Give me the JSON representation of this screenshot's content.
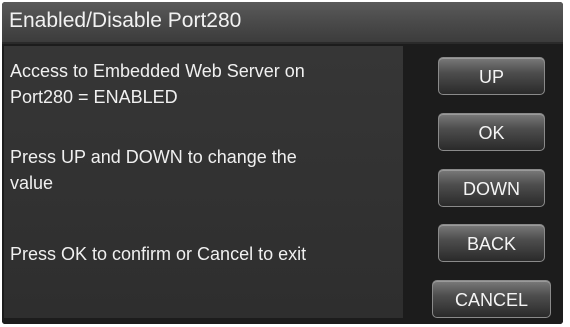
{
  "title": "Enabled/Disable Port280",
  "messages": {
    "access_line1": "Access to Embedded Web Server on",
    "access_line2": "Port280 = ENABLED",
    "instruction_line1": "Press UP and DOWN to change the",
    "instruction_line2": "value",
    "confirm": "Press OK to confirm or Cancel to exit"
  },
  "buttons": {
    "up": "UP",
    "ok": "OK",
    "down": "DOWN",
    "back": "BACK",
    "cancel": "CANCEL"
  },
  "colors": {
    "background": "#000000",
    "title_bar": "#4a4a4a",
    "panel": "#333333",
    "text": "#f0f0f0",
    "button": "#4e4e4e"
  }
}
